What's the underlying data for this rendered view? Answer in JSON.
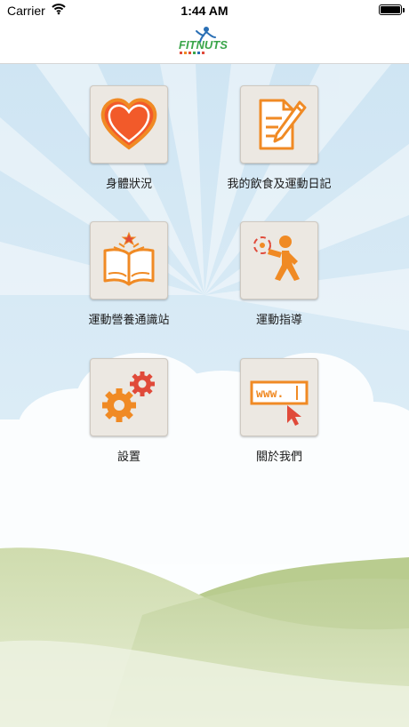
{
  "status_bar": {
    "carrier": "Carrier",
    "time": "1:44 AM"
  },
  "nav": {
    "logo_text": "FITNUTS"
  },
  "menu": [
    {
      "label": "身體狀況",
      "icon": "heart-icon"
    },
    {
      "label": "我的飲食及運動日記",
      "icon": "diary-pencil-icon"
    },
    {
      "label": "運動營養通識站",
      "icon": "open-book-icon"
    },
    {
      "label": "運動指導",
      "icon": "exercise-person-icon"
    },
    {
      "label": "設置",
      "icon": "gears-icon"
    },
    {
      "label": "關於我們",
      "icon": "www-cursor-icon"
    }
  ],
  "colors": {
    "accent": "#f08a24",
    "heart_fill": "#f25a2a",
    "logo_green": "#3aa54a",
    "logo_blue": "#2a6fb5"
  }
}
